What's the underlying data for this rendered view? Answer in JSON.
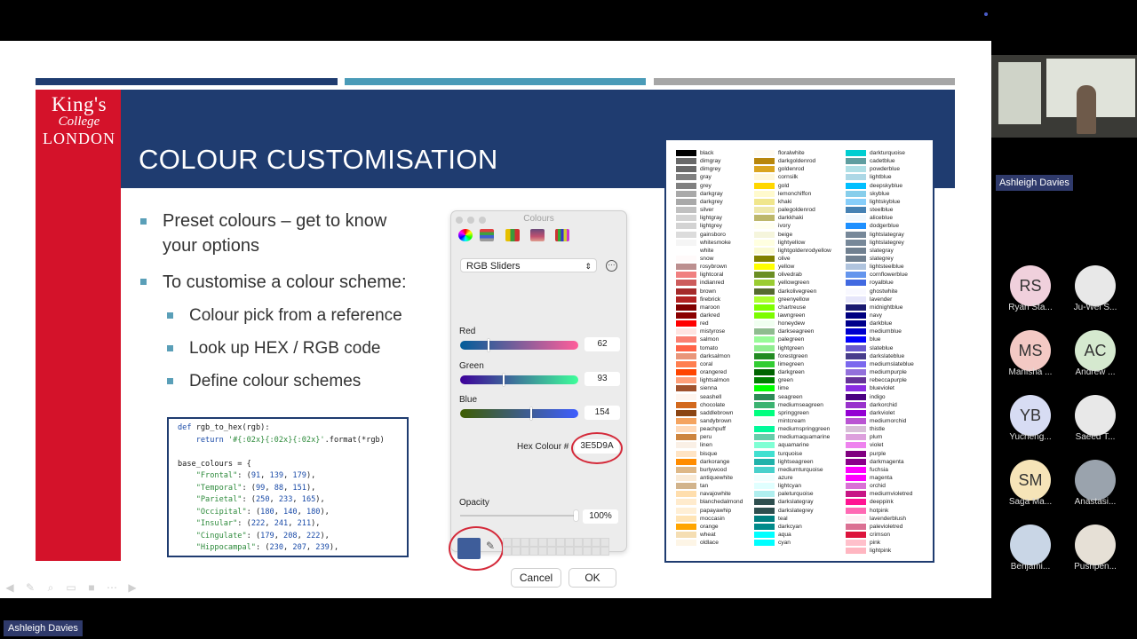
{
  "slide": {
    "logo": {
      "line1": "King's",
      "line2": "College",
      "line3": "LONDON"
    },
    "title": "COLOUR CUSTOMISATION",
    "bullets": [
      {
        "text_l1": "Preset colours – get to know",
        "text_l2": "your options"
      },
      {
        "text": "To customise a colour scheme:"
      }
    ],
    "sub_bullets": [
      "Colour pick from a reference",
      "Look up HEX / RGB code",
      "Define colour schemes"
    ],
    "code_lines": [
      "def rgb_to_hex(rgb):",
      "    return '#{:02x}{:02x}{:02x}'.format(*rgb)",
      "",
      "base_colours = {",
      "    \"Frontal\": (91, 139, 179),",
      "    \"Temporal\": (99, 88, 151),",
      "    \"Parietal\": (250, 233, 165),",
      "    \"Occipital\": (180, 140, 180),",
      "    \"Insular\": (222, 241, 211),",
      "    \"Cingulate\": (179, 208, 222),",
      "    \"Hippocampal\": (230, 207, 239),"
    ],
    "colours": {
      "navy": "#1f3c70",
      "red": "#d4122a",
      "teal": "#4a9bb8",
      "grey": "#a6a6a6"
    }
  },
  "dialog": {
    "title": "Colours",
    "mode": "RGB Sliders",
    "red_label": "Red",
    "red_value": "62",
    "red_fraction": 0.243,
    "green_label": "Green",
    "green_value": "93",
    "green_fraction": 0.365,
    "blue_label": "Blue",
    "blue_value": "154",
    "blue_fraction": 0.604,
    "hex_label": "Hex Colour #",
    "hex_value": "3E5D9A",
    "opacity_label": "Opacity",
    "opacity_value": "100%",
    "opacity_fraction": 1.0,
    "current_colour": "#3e5d9a",
    "cancel": "Cancel",
    "ok": "OK"
  },
  "named_colours": {
    "col1": [
      [
        "black",
        "#000000"
      ],
      [
        "dimgray",
        "#696969"
      ],
      [
        "dimgrey",
        "#696969"
      ],
      [
        "gray",
        "#808080"
      ],
      [
        "grey",
        "#808080"
      ],
      [
        "darkgray",
        "#a9a9a9"
      ],
      [
        "darkgrey",
        "#a9a9a9"
      ],
      [
        "silver",
        "#c0c0c0"
      ],
      [
        "lightgray",
        "#d3d3d3"
      ],
      [
        "lightgrey",
        "#d3d3d3"
      ],
      [
        "gainsboro",
        "#dcdcdc"
      ],
      [
        "whitesmoke",
        "#f5f5f5"
      ],
      [
        "white",
        "#ffffff"
      ],
      [
        "snow",
        "#fffafa"
      ],
      [
        "rosybrown",
        "#bc8f8f"
      ],
      [
        "lightcoral",
        "#f08080"
      ],
      [
        "indianred",
        "#cd5c5c"
      ],
      [
        "brown",
        "#a52a2a"
      ],
      [
        "firebrick",
        "#b22222"
      ],
      [
        "maroon",
        "#800000"
      ],
      [
        "darkred",
        "#8b0000"
      ],
      [
        "red",
        "#ff0000"
      ],
      [
        "mistyrose",
        "#ffe4e1"
      ],
      [
        "salmon",
        "#fa8072"
      ],
      [
        "tomato",
        "#ff6347"
      ],
      [
        "darksalmon",
        "#e9967a"
      ],
      [
        "coral",
        "#ff7f50"
      ],
      [
        "orangered",
        "#ff4500"
      ],
      [
        "lightsalmon",
        "#ffa07a"
      ],
      [
        "sienna",
        "#a0522d"
      ],
      [
        "seashell",
        "#fff5ee"
      ],
      [
        "chocolate",
        "#d2691e"
      ],
      [
        "saddlebrown",
        "#8b4513"
      ],
      [
        "sandybrown",
        "#f4a460"
      ],
      [
        "peachpuff",
        "#ffdab9"
      ],
      [
        "peru",
        "#cd853f"
      ],
      [
        "linen",
        "#faf0e6"
      ],
      [
        "bisque",
        "#ffe4c4"
      ],
      [
        "darkorange",
        "#ff8c00"
      ],
      [
        "burlywood",
        "#deb887"
      ],
      [
        "antiquewhite",
        "#faebd7"
      ],
      [
        "tan",
        "#d2b48c"
      ],
      [
        "navajowhite",
        "#ffdead"
      ],
      [
        "blanchedalmond",
        "#ffebcd"
      ],
      [
        "papayawhip",
        "#ffefd5"
      ],
      [
        "moccasin",
        "#ffe4b5"
      ],
      [
        "orange",
        "#ffa500"
      ],
      [
        "wheat",
        "#f5deb3"
      ],
      [
        "oldlace",
        "#fdf5e6"
      ]
    ],
    "col2": [
      [
        "floralwhite",
        "#fffaf0"
      ],
      [
        "darkgoldenrod",
        "#b8860b"
      ],
      [
        "goldenrod",
        "#daa520"
      ],
      [
        "cornsilk",
        "#fff8dc"
      ],
      [
        "gold",
        "#ffd700"
      ],
      [
        "lemonchiffon",
        "#fffacd"
      ],
      [
        "khaki",
        "#f0e68c"
      ],
      [
        "palegoldenrod",
        "#eee8aa"
      ],
      [
        "darkkhaki",
        "#bdb76b"
      ],
      [
        "ivory",
        "#fffff0"
      ],
      [
        "beige",
        "#f5f5dc"
      ],
      [
        "lightyellow",
        "#ffffe0"
      ],
      [
        "lightgoldenrodyellow",
        "#fafad2"
      ],
      [
        "olive",
        "#808000"
      ],
      [
        "yellow",
        "#ffff00"
      ],
      [
        "olivedrab",
        "#6b8e23"
      ],
      [
        "yellowgreen",
        "#9acd32"
      ],
      [
        "darkolivegreen",
        "#556b2f"
      ],
      [
        "greenyellow",
        "#adff2f"
      ],
      [
        "chartreuse",
        "#7fff00"
      ],
      [
        "lawngreen",
        "#7cfc00"
      ],
      [
        "honeydew",
        "#f0fff0"
      ],
      [
        "darkseagreen",
        "#8fbc8f"
      ],
      [
        "palegreen",
        "#98fb98"
      ],
      [
        "lightgreen",
        "#90ee90"
      ],
      [
        "forestgreen",
        "#228b22"
      ],
      [
        "limegreen",
        "#32cd32"
      ],
      [
        "darkgreen",
        "#006400"
      ],
      [
        "green",
        "#008000"
      ],
      [
        "lime",
        "#00ff00"
      ],
      [
        "seagreen",
        "#2e8b57"
      ],
      [
        "mediumseagreen",
        "#3cb371"
      ],
      [
        "springgreen",
        "#00ff7f"
      ],
      [
        "mintcream",
        "#f5fffa"
      ],
      [
        "mediumspringgreen",
        "#00fa9a"
      ],
      [
        "mediumaquamarine",
        "#66cdaa"
      ],
      [
        "aquamarine",
        "#7fffd4"
      ],
      [
        "turquoise",
        "#40e0d0"
      ],
      [
        "lightseagreen",
        "#20b2aa"
      ],
      [
        "mediumturquoise",
        "#48d1cc"
      ],
      [
        "azure",
        "#f0ffff"
      ],
      [
        "lightcyan",
        "#e0ffff"
      ],
      [
        "paleturquoise",
        "#afeeee"
      ],
      [
        "darkslategray",
        "#2f4f4f"
      ],
      [
        "darkslategrey",
        "#2f4f4f"
      ],
      [
        "teal",
        "#008080"
      ],
      [
        "darkcyan",
        "#008b8b"
      ],
      [
        "aqua",
        "#00ffff"
      ],
      [
        "cyan",
        "#00ffff"
      ]
    ],
    "col3": [
      [
        "darkturquoise",
        "#00ced1"
      ],
      [
        "cadetblue",
        "#5f9ea0"
      ],
      [
        "powderblue",
        "#b0e0e6"
      ],
      [
        "lightblue",
        "#add8e6"
      ],
      [
        "deepskyblue",
        "#00bfff"
      ],
      [
        "skyblue",
        "#87ceeb"
      ],
      [
        "lightskyblue",
        "#87cefa"
      ],
      [
        "steelblue",
        "#4682b4"
      ],
      [
        "aliceblue",
        "#f0f8ff"
      ],
      [
        "dodgerblue",
        "#1e90ff"
      ],
      [
        "lightslategray",
        "#778899"
      ],
      [
        "lightslategrey",
        "#778899"
      ],
      [
        "slategray",
        "#708090"
      ],
      [
        "slategrey",
        "#708090"
      ],
      [
        "lightsteelblue",
        "#b0c4de"
      ],
      [
        "cornflowerblue",
        "#6495ed"
      ],
      [
        "royalblue",
        "#4169e1"
      ],
      [
        "ghostwhite",
        "#f8f8ff"
      ],
      [
        "lavender",
        "#e6e6fa"
      ],
      [
        "midnightblue",
        "#191970"
      ],
      [
        "navy",
        "#000080"
      ],
      [
        "darkblue",
        "#00008b"
      ],
      [
        "mediumblue",
        "#0000cd"
      ],
      [
        "blue",
        "#0000ff"
      ],
      [
        "slateblue",
        "#6a5acd"
      ],
      [
        "darkslateblue",
        "#483d8b"
      ],
      [
        "mediumslateblue",
        "#7b68ee"
      ],
      [
        "mediumpurple",
        "#9370db"
      ],
      [
        "rebeccapurple",
        "#663399"
      ],
      [
        "blueviolet",
        "#8a2be2"
      ],
      [
        "indigo",
        "#4b0082"
      ],
      [
        "darkorchid",
        "#9932cc"
      ],
      [
        "darkviolet",
        "#9400d3"
      ],
      [
        "mediumorchid",
        "#ba55d3"
      ],
      [
        "thistle",
        "#d8bfd8"
      ],
      [
        "plum",
        "#dda0dd"
      ],
      [
        "violet",
        "#ee82ee"
      ],
      [
        "purple",
        "#800080"
      ],
      [
        "darkmagenta",
        "#8b008b"
      ],
      [
        "fuchsia",
        "#ff00ff"
      ],
      [
        "magenta",
        "#ff00ff"
      ],
      [
        "orchid",
        "#da70d6"
      ],
      [
        "mediumvioletred",
        "#c71585"
      ],
      [
        "deeppink",
        "#ff1493"
      ],
      [
        "hotpink",
        "#ff69b4"
      ],
      [
        "lavenderblush",
        "#fff0f5"
      ],
      [
        "palevioletred",
        "#db7093"
      ],
      [
        "crimson",
        "#dc143c"
      ],
      [
        "pink",
        "#ffc0cb"
      ],
      [
        "lightpink",
        "#ffb6c1"
      ]
    ]
  },
  "meeting": {
    "presenter_name": "Ashleigh Davies",
    "participants": [
      {
        "initials": "RS",
        "name": "Ryan Sta...",
        "color": "#f0d0dc"
      },
      {
        "initials": "",
        "name": "Ju-Wei S...",
        "color": "#e8e8e8"
      },
      {
        "initials": "MS",
        "name": "Manisha ...",
        "color": "#f3c9c4"
      },
      {
        "initials": "AC",
        "name": "Andrew ...",
        "color": "#d5e9cf"
      },
      {
        "initials": "YB",
        "name": "Yucheng...",
        "color": "#d7dcf3"
      },
      {
        "initials": "",
        "name": "Saeed T...",
        "color": "#e8e8e8"
      },
      {
        "initials": "SM",
        "name": "Saga Ma...",
        "color": "#f6e4b8"
      },
      {
        "initials": "",
        "name": "Anastasi...",
        "color": "#9aa3ad"
      },
      {
        "initials": "",
        "name": "Benjami...",
        "color": "#c9d6e6"
      },
      {
        "initials": "",
        "name": "Pushpen...",
        "color": "#e6e0d6"
      }
    ],
    "self_name": "Ashleigh Davies"
  },
  "controls": [
    "back-icon",
    "pen-icon",
    "zoom-icon",
    "subtitles-icon",
    "camera-icon",
    "more-icon",
    "forward-icon"
  ]
}
